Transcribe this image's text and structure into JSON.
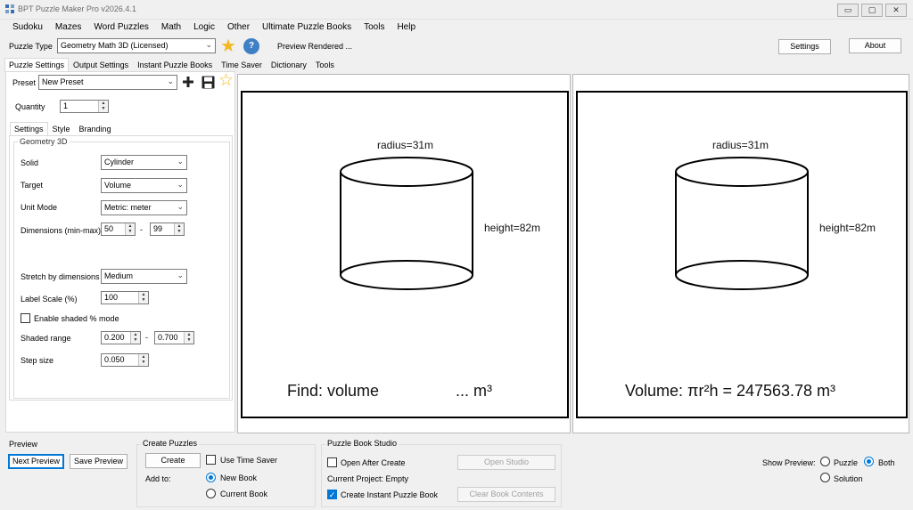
{
  "window": {
    "title": "BPT Puzzle Maker Pro v2026.4.1",
    "min_glyph": "▭",
    "max_glyph": "▢",
    "close_glyph": "✕"
  },
  "menu": [
    "Sudoku",
    "Mazes",
    "Word Puzzles",
    "Math",
    "Logic",
    "Other",
    "Ultimate Puzzle Books",
    "Tools",
    "Help"
  ],
  "toolbar": {
    "puzzle_type_label": "Puzzle Type",
    "puzzle_type_value": "Geometry Math 3D (Licensed)",
    "help_glyph": "?",
    "status": "Preview Rendered ...",
    "settings_button": "Settings",
    "about_button": "About"
  },
  "main_tabs": [
    "Puzzle Settings",
    "Output Settings",
    "Instant Puzzle Books",
    "Time Saver",
    "Dictionary",
    "Tools"
  ],
  "preset": {
    "label": "Preset",
    "value": "New Preset"
  },
  "quantity": {
    "label": "Quantity",
    "value": "1"
  },
  "sub_tabs": [
    "Settings",
    "Style",
    "Branding"
  ],
  "geometry": {
    "group_title": "Geometry 3D",
    "solid_label": "Solid",
    "solid_value": "Cylinder",
    "target_label": "Target",
    "target_value": "Volume",
    "unit_mode_label": "Unit Mode",
    "unit_mode_value": "Metric: meter",
    "dimensions_label": "Dimensions (min-max)",
    "dim_min": "50",
    "dim_max": "99",
    "dash": "-",
    "stretch_label": "Stretch by dimensions",
    "stretch_value": "Medium",
    "label_scale_label": "Label Scale (%)",
    "label_scale_value": "100",
    "shaded_mode_label": "Enable shaded % mode",
    "shaded_range_label": "Shaded range",
    "shaded_min": "0.200",
    "shaded_max": "0.700",
    "step_size_label": "Step size",
    "step_size_value": "0.050"
  },
  "puzzle_preview": {
    "radius_label": "radius=31m",
    "height_label": "height=82m",
    "find_text": "Find: volume",
    "blank_text": "... m³"
  },
  "solution_preview": {
    "radius_label": "radius=31m",
    "height_label": "height=82m",
    "answer_text": "Volume: πr²h = 247563.78 m³"
  },
  "bottom": {
    "preview_title": "Preview",
    "next_preview": "Next Preview",
    "save_preview": "Save Preview",
    "create_title": "Create Puzzles",
    "create_button": "Create",
    "use_time_saver": "Use Time Saver",
    "add_to_label": "Add to:",
    "new_book": "New Book",
    "current_book": "Current Book",
    "studio_title": "Puzzle Book Studio",
    "open_after_create": "Open After Create",
    "open_studio": "Open Studio",
    "current_project": "Current Project: Empty",
    "create_instant": "Create Instant Puzzle Book",
    "clear_book": "Clear Book Contents",
    "show_preview_label": "Show Preview:",
    "opt_puzzle": "Puzzle",
    "opt_both": "Both",
    "opt_solution": "Solution"
  },
  "colors": {
    "accent": "#0078d7",
    "star": "#f2b824",
    "help": "#3f7fc6",
    "background": "#f0f0f0"
  }
}
